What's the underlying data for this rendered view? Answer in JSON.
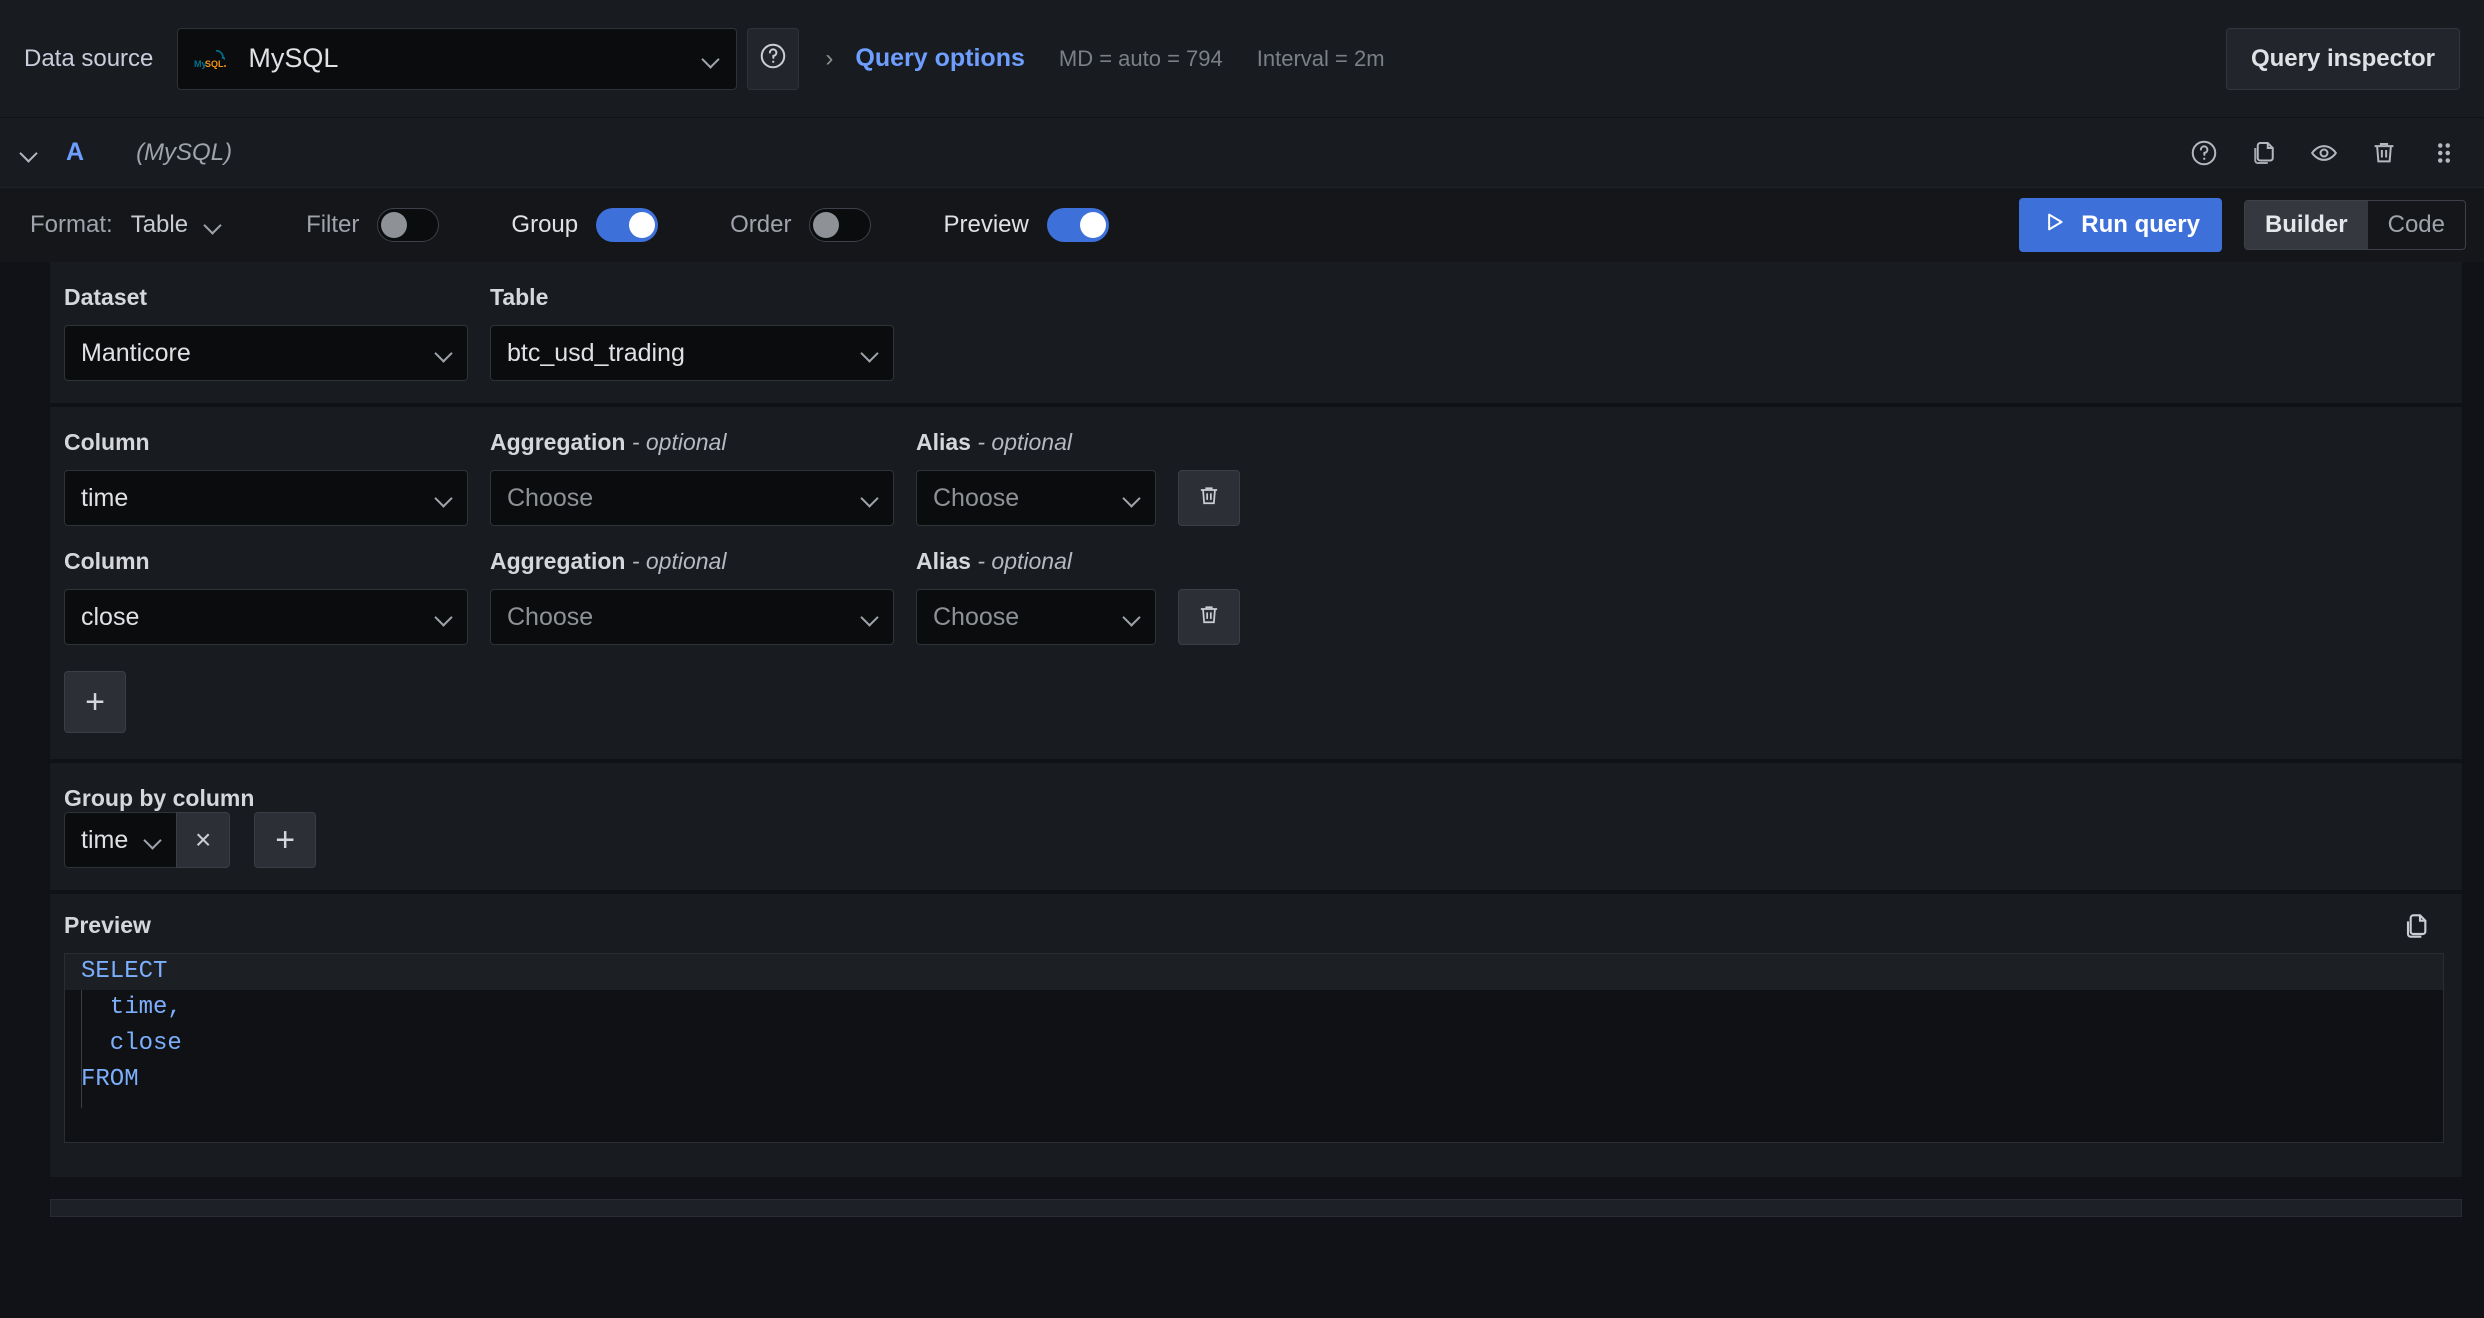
{
  "topbar": {
    "datasource_label": "Data source",
    "datasource_value": "MySQL",
    "datasource_icon": "mysql-logo-icon",
    "help_icon": "circle-question-icon",
    "expand_icon": "chevron-right-icon",
    "query_options_label": "Query options",
    "query_options_meta_md": "MD = auto = 794",
    "query_options_meta_interval": "Interval = 2m",
    "query_inspector_label": "Query inspector"
  },
  "query_row": {
    "collapse_icon": "chevron-down-icon",
    "ref_id": "A",
    "datasource_note": "(MySQL)",
    "actions": [
      {
        "name": "help-icon",
        "title": "Show data source help"
      },
      {
        "name": "copy-icon",
        "title": "Duplicate query"
      },
      {
        "name": "eye-icon",
        "title": "Disable/enable query"
      },
      {
        "name": "trash-icon",
        "title": "Remove query"
      },
      {
        "name": "drag-handle-icon",
        "title": "Drag and drop to reorder"
      }
    ]
  },
  "toolbar": {
    "format_label": "Format:",
    "format_value": "Table",
    "toggles": [
      {
        "label": "Filter",
        "on": false
      },
      {
        "label": "Group",
        "on": true
      },
      {
        "label": "Order",
        "on": false
      },
      {
        "label": "Preview",
        "on": true
      }
    ],
    "run_query_label": "Run query",
    "run_icon": "play-icon",
    "editor_modes": [
      {
        "label": "Builder",
        "active": true
      },
      {
        "label": "Code",
        "active": false
      }
    ],
    "accent_color": "#3d71d9"
  },
  "source_section": {
    "dataset_label": "Dataset",
    "dataset_value": "Manticore",
    "table_label": "Table",
    "table_value": "btc_usd_trading"
  },
  "columns_section": {
    "column_label": "Column",
    "aggregation_label": "Aggregation",
    "alias_label": "Alias",
    "optional_suffix": "- optional",
    "choose_placeholder": "Choose",
    "rows": [
      {
        "column": "time",
        "aggregation": "Choose",
        "alias": "Choose",
        "delete_icon": "trash-icon"
      },
      {
        "column": "close",
        "aggregation": "Choose",
        "alias": "Choose",
        "delete_icon": "trash-icon"
      }
    ],
    "add_label": "+"
  },
  "group_section": {
    "label": "Group by column",
    "items": [
      {
        "value": "time",
        "remove_label": "×"
      }
    ],
    "add_label": "+"
  },
  "preview_section": {
    "title": "Preview",
    "copy_icon": "copy-icon",
    "sql_lines": [
      {
        "text": "SELECT",
        "current": true
      },
      {
        "text": "  time,",
        "current": false
      },
      {
        "text": "  close",
        "current": false
      },
      {
        "text": "FROM",
        "current": false
      }
    ]
  }
}
